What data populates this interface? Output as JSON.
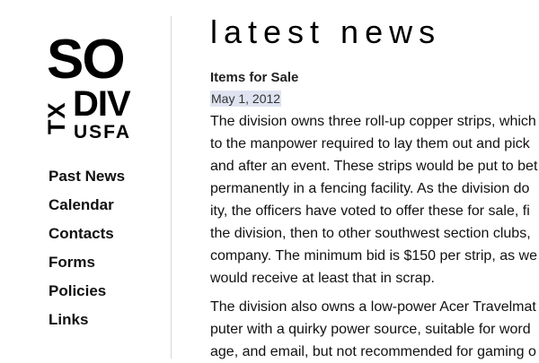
{
  "logo": {
    "line1": "SO",
    "vertical": "TX",
    "line2": "DIV",
    "line3": "USFA"
  },
  "nav": {
    "items": [
      {
        "label": "Past News"
      },
      {
        "label": "Calendar"
      },
      {
        "label": "Contacts"
      },
      {
        "label": "Forms"
      },
      {
        "label": "Policies"
      },
      {
        "label": "Links"
      }
    ]
  },
  "main": {
    "page_title": "latest news",
    "article": {
      "title": "Items for Sale",
      "date": "May 1, 2012",
      "paragraph1": [
        "The division owns three roll-up copper strips, which",
        "to the manpower required to lay them out and pick",
        "and after an event. These strips would be put to bet",
        "permanently in a fencing facility. As the division do",
        "ity, the officers have voted to offer these for sale, fi",
        "the division, then to other southwest section clubs,",
        "company. The minimum bid is $150 per strip, as we",
        "would receive at least that in scrap."
      ],
      "paragraph2": [
        "The division also owns a low-power Acer Travelmat",
        "puter with a quirky power source, suitable for word",
        "age, and email, but not recommended for gaming o"
      ]
    }
  },
  "colors": {
    "background": "#ffffff",
    "text": "#111111",
    "divider": "#d6d6d6",
    "date_highlight": "#dfe3f1"
  }
}
